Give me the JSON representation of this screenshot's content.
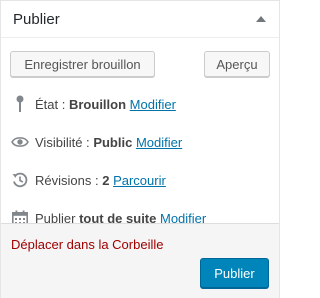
{
  "box": {
    "title": "Publier",
    "toggle_icon": "triangle-up-icon"
  },
  "actions": {
    "save_draft_label": "Enregistrer brouillon",
    "preview_label": "Aperçu"
  },
  "status": {
    "icon": "pin-icon",
    "label": "État :",
    "value": "Brouillon",
    "link": "Modifier"
  },
  "visibility": {
    "icon": "eye-icon",
    "label": "Visibilité :",
    "value": "Public",
    "link": "Modifier"
  },
  "revisions": {
    "icon": "backup-icon",
    "label": "Révisions :",
    "value": "2",
    "link": "Parcourir"
  },
  "schedule": {
    "icon": "calendar-icon",
    "label": "Publier",
    "value": "tout de suite",
    "link": "Modifier"
  },
  "major": {
    "trash_label": "Déplacer dans la Corbeille",
    "publish_label": "Publier"
  },
  "colors": {
    "link": "#0073aa",
    "trash": "#a00000",
    "primary_button": "#0085ba"
  }
}
